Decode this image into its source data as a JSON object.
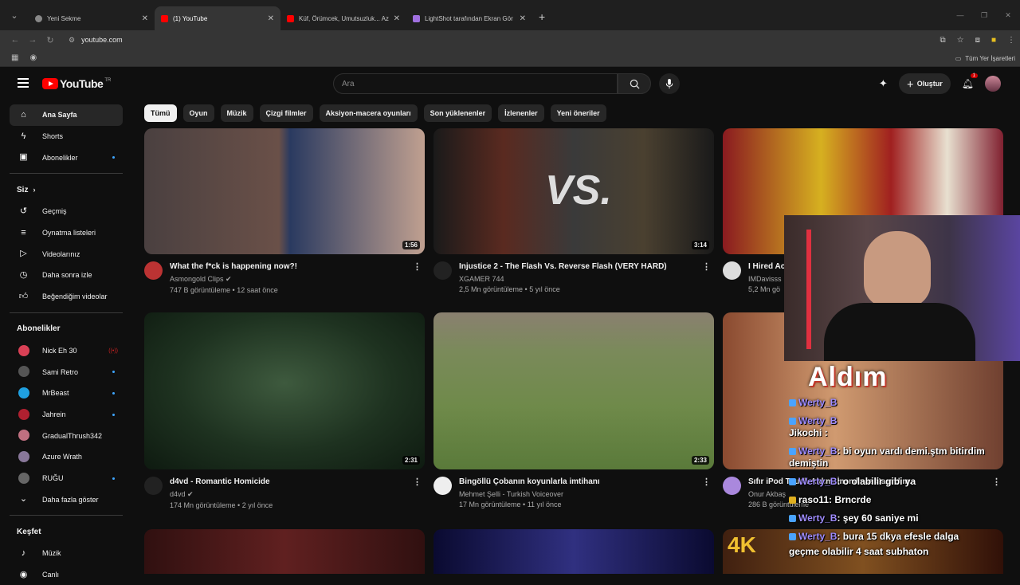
{
  "browser": {
    "tabs": [
      {
        "title": "Yeni Sekme",
        "active": false
      },
      {
        "title": "(1) YouTube",
        "active": true
      },
      {
        "title": "Küf, Örümcek, Umutsuzluk... Az",
        "active": false
      },
      {
        "title": "LightShot tarafından Ekran Gör",
        "active": false
      }
    ],
    "url": "youtube.com",
    "all_bookmarks": "Tüm Yer İşaretleri"
  },
  "youtube": {
    "logo_text": "YouTube",
    "country_code": "TR",
    "search_placeholder": "Ara",
    "create_label": "Oluştur",
    "notification_count": "1"
  },
  "sidebar": {
    "main": [
      {
        "label": "Ana Sayfa",
        "icon": "home-icon",
        "active": true
      },
      {
        "label": "Shorts",
        "icon": "shorts-icon"
      },
      {
        "label": "Abonelikler",
        "icon": "subscriptions-icon",
        "dot": true
      }
    ],
    "you_header": "Siz",
    "you": [
      {
        "label": "Geçmiş",
        "icon": "history-icon"
      },
      {
        "label": "Oynatma listeleri",
        "icon": "playlist-icon"
      },
      {
        "label": "Videolarınız",
        "icon": "your-videos-icon"
      },
      {
        "label": "Daha sonra izle",
        "icon": "watch-later-icon"
      },
      {
        "label": "Beğendiğim videolar",
        "icon": "like-icon"
      }
    ],
    "subs_header": "Abonelikler",
    "subs": [
      {
        "label": "Nick Eh 30",
        "color": "#d94055",
        "live": true
      },
      {
        "label": "Sami Retro",
        "color": "#555555",
        "dot": true
      },
      {
        "label": "MrBeast",
        "color": "#1fa0e0",
        "dot": true
      },
      {
        "label": "Jahrein",
        "color": "#b02030",
        "dot": true
      },
      {
        "label": "GradualThrush342",
        "color": "#c07080"
      },
      {
        "label": "Azure Wrath",
        "color": "#887799"
      },
      {
        "label": "RUĞU",
        "color": "#666666",
        "dot": true
      }
    ],
    "show_more": "Daha fazla göster",
    "explore_header": "Keşfet",
    "explore": [
      {
        "label": "Müzik",
        "icon": "music-icon"
      },
      {
        "label": "Canlı",
        "icon": "live-icon"
      }
    ]
  },
  "chips": [
    "Tümü",
    "Oyun",
    "Müzik",
    "Çizgi filmler",
    "Aksiyon-macera oyunları",
    "Son yüklenenler",
    "İzlenenler",
    "Yeni öneriler"
  ],
  "videos": [
    {
      "title": "What the f*ck is happening now?!",
      "channel": "Asmongold Clips",
      "verified": true,
      "stats": "747 B görüntüleme • 12 saat önce",
      "duration": "1:56",
      "thumb": "#5a4a45",
      "avatar": "#b33"
    },
    {
      "title": "Injustice 2 - The Flash Vs. Reverse Flash (VERY HARD)",
      "channel": "XGAMER 744",
      "verified": false,
      "stats": "2,5 Mn görüntüleme • 5 yıl önce",
      "duration": "3:14",
      "thumb": "#2a2a2a",
      "avatar": "#222"
    },
    {
      "title": "I Hired Ac",
      "channel": "IMDavisss",
      "verified": false,
      "stats": "5,2 Mn gö",
      "duration": "",
      "thumb": "#c2a020",
      "avatar": "#ddd"
    },
    {
      "title": "d4vd - Romantic Homicide",
      "channel": "d4vd",
      "verified": true,
      "stats": "174 Mn görüntüleme • 2 yıl önce",
      "duration": "2:31",
      "thumb": "#1f3a24",
      "avatar": "#222"
    },
    {
      "title": "Bingöllü Çobanın koyunlarla imtihanı",
      "channel": "Mehmet Şelli - Turkish Voiceover",
      "verified": false,
      "stats": "17 Mn görüntüleme • 11 yıl önce",
      "duration": "2:33",
      "thumb": "#6f8a4a",
      "avatar": "#eee"
    },
    {
      "title": "Sıfır iPod Touch Aldım. İnanılmaz Şaşırdım.",
      "channel": "Onur Akbaş",
      "verified": false,
      "stats": "286 B görüntüleme",
      "duration": "",
      "thumb": "#b07050",
      "avatar": "#a8d"
    }
  ],
  "overlay": {
    "word": "Aldım",
    "chat": [
      {
        "name": "Werty_B",
        "msg": ""
      },
      {
        "name": "Werty_B",
        "msg": ""
      },
      {
        "name": "Jikochi",
        "msg": ":"
      },
      {
        "name": "Werty_B",
        "msg": ": bi oyun vardı demi.ştm bitirdim"
      },
      {
        "name": "",
        "msg": "demiştin"
      },
      {
        "name": "Werty_B",
        "msg": ": o olabilir gibi ya"
      },
      {
        "name": "raso11",
        "msg": ": Brncrde"
      },
      {
        "name": "Werty_B",
        "msg": ": şey 60 saniye mi"
      },
      {
        "name": "Werty_B",
        "msg": ": bura 15 dkya efesle dalga"
      },
      {
        "name": "",
        "msg": "geçme olabilir 4 saat subhaton"
      }
    ]
  }
}
